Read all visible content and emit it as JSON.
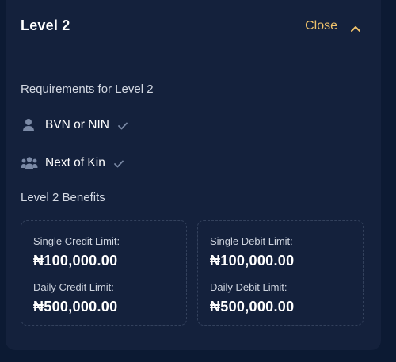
{
  "header": {
    "title": "Level 2",
    "close_label": "Close"
  },
  "requirements": {
    "title": "Requirements for Level 2",
    "items": [
      {
        "label": "BVN or NIN",
        "icon": "person-icon",
        "met": true
      },
      {
        "label": "Next of Kin",
        "icon": "people-group-icon",
        "met": true
      }
    ]
  },
  "benefits": {
    "title": "Level 2 Benefits",
    "credit": {
      "single_label": "Single Credit Limit:",
      "single_value": "₦100,000.00",
      "daily_label": "Daily Credit Limit:",
      "daily_value": "₦500,000.00"
    },
    "debit": {
      "single_label": "Single Debit Limit:",
      "single_value": "₦100,000.00",
      "daily_label": "Daily Debit Limit:",
      "daily_value": "₦500,000.00"
    }
  },
  "colors": {
    "background": "#0c1a33",
    "card": "#14213c",
    "accent": "#f1c36b",
    "icon": "#7b8aa6"
  }
}
